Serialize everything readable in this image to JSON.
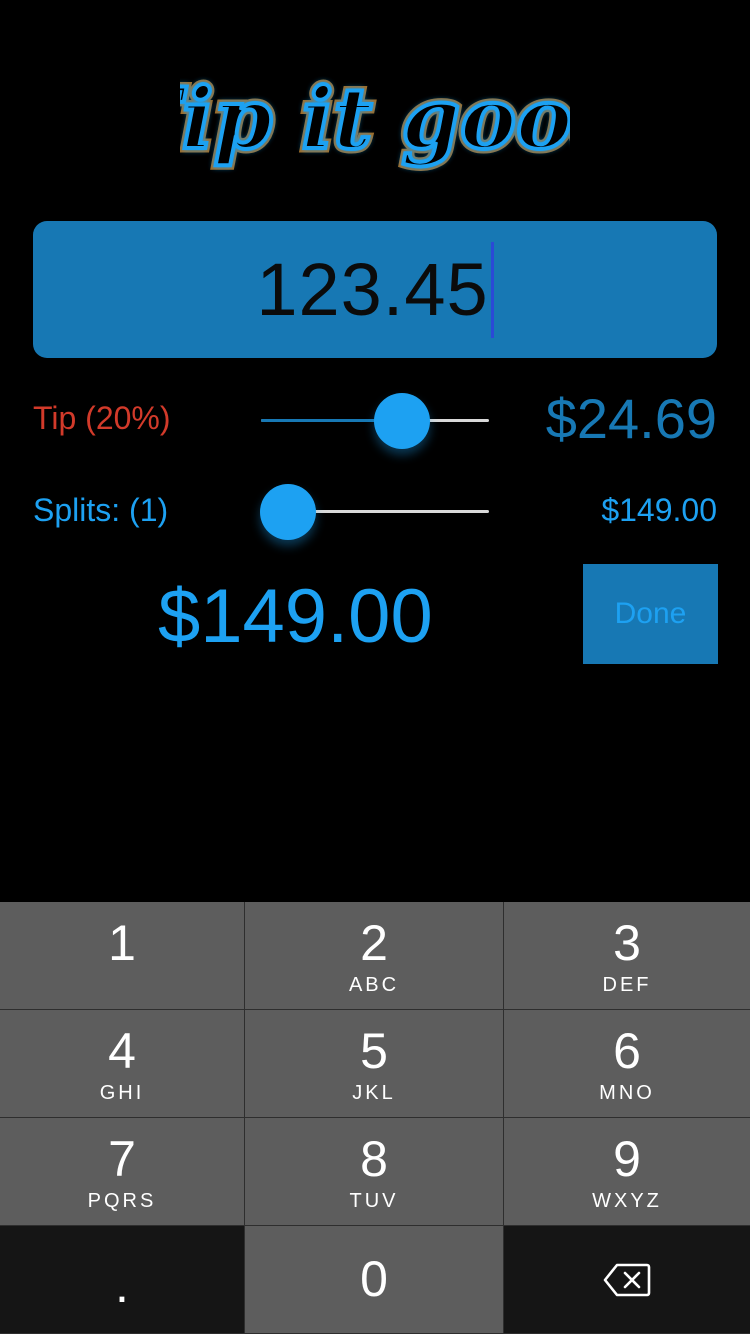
{
  "app": {
    "logo_text": "Tip it good"
  },
  "amount_field": {
    "value": "123.45"
  },
  "tip": {
    "label": "Tip (20%)",
    "amount": "$24.69",
    "slider_fraction": 0.62
  },
  "splits": {
    "label": "Splits: (1)",
    "per_person": "$149.00",
    "slider_fraction": 0.12
  },
  "total": {
    "amount": "$149.00"
  },
  "done_button": {
    "label": "Done"
  },
  "keypad": {
    "keys": [
      {
        "num": "1",
        "letters": ""
      },
      {
        "num": "2",
        "letters": "ABC"
      },
      {
        "num": "3",
        "letters": "DEF"
      },
      {
        "num": "4",
        "letters": "GHI"
      },
      {
        "num": "5",
        "letters": "JKL"
      },
      {
        "num": "6",
        "letters": "MNO"
      },
      {
        "num": "7",
        "letters": "PQRS"
      },
      {
        "num": "8",
        "letters": "TUV"
      },
      {
        "num": "9",
        "letters": "WXYZ"
      }
    ],
    "decimal": ".",
    "zero": "0",
    "backspace_icon": "backspace-icon"
  },
  "colors": {
    "accent": "#1da1f2",
    "field_blue": "#1778b4",
    "tip_red": "#d23a2a"
  }
}
